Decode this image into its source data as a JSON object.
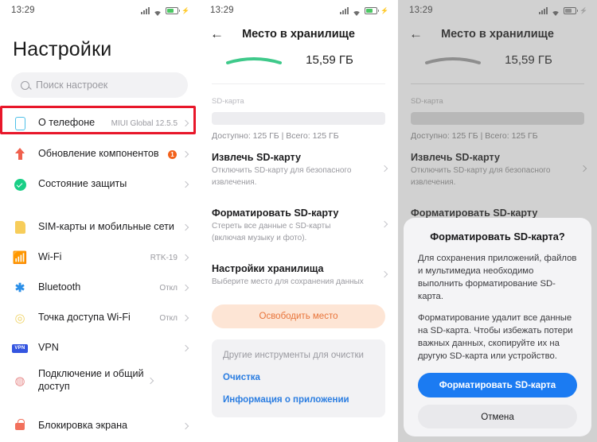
{
  "status": {
    "time": "13:29",
    "icons": [
      "signal-icon",
      "wifi-icon",
      "battery-icon",
      "charging-bolt-icon"
    ]
  },
  "panel1": {
    "title": "Настройки",
    "search_placeholder": "Поиск настроек",
    "items": [
      {
        "icon": "phone-icon",
        "label": "О телефоне",
        "value": "MIUI Global 12.5.5",
        "highlighted": true
      },
      {
        "icon": "up-arrow-icon",
        "label": "Обновление компонентов",
        "value": "",
        "badge": "1"
      },
      {
        "icon": "shield-check-icon",
        "label": "Состояние защиты",
        "value": ""
      },
      {
        "icon": "sim-card-icon",
        "label": "SIM-карты и мобильные сети",
        "value": ""
      },
      {
        "icon": "wifi-icon",
        "label": "Wi-Fi",
        "value": "RTK-19"
      },
      {
        "icon": "bluetooth-icon",
        "label": "Bluetooth",
        "value": "Откл"
      },
      {
        "icon": "hotspot-icon",
        "label": "Точка доступа Wi-Fi",
        "value": "Откл"
      },
      {
        "icon": "vpn-icon",
        "label": "VPN",
        "value": ""
      },
      {
        "icon": "share-icon",
        "label": "Подключение и общий доступ",
        "value": ""
      },
      {
        "icon": "lock-icon",
        "label": "Блокировка экрана",
        "value": ""
      }
    ]
  },
  "storage": {
    "back_icon": "back-arrow-icon",
    "title": "Место в хранилище",
    "used": "15,59 ГБ",
    "sd_label": "SD-карта",
    "capacity": "Доступно: 125 ГБ | Всего: 125 ГБ",
    "sections": [
      {
        "title": "Извлечь SD-карту",
        "subtitle": "Отключить SD-карту для безопасного извлечения."
      },
      {
        "title": "Форматировать SD-карту",
        "subtitle": "Стереть все данные с SD-карты (включая музыку и фото).",
        "highlighted": true
      },
      {
        "title": "Настройки хранилища",
        "subtitle": "Выберите место для сохранения данных"
      }
    ],
    "free_button": "Освободить место",
    "tools_header": "Другие инструменты для очистки",
    "tools_links": [
      "Очистка",
      "Информация о приложении"
    ]
  },
  "dialog": {
    "title": "Форматировать SD-карта?",
    "paragraphs": [
      "Для сохранения приложений, файлов и мультимедиа необходимо выполнить форматирование SD-карта.",
      "Форматирование удалит все данные на SD-карта. Чтобы избежать потери важных данных, скопируйте их на другую SD-карта или устройство."
    ],
    "confirm_label": "Форматировать SD-карта",
    "cancel_label": "Отмена"
  },
  "colors": {
    "accent_red": "#e8172a",
    "primary_blue": "#1b7bf2",
    "green": "#19cf86",
    "orange": "#f2611b"
  }
}
